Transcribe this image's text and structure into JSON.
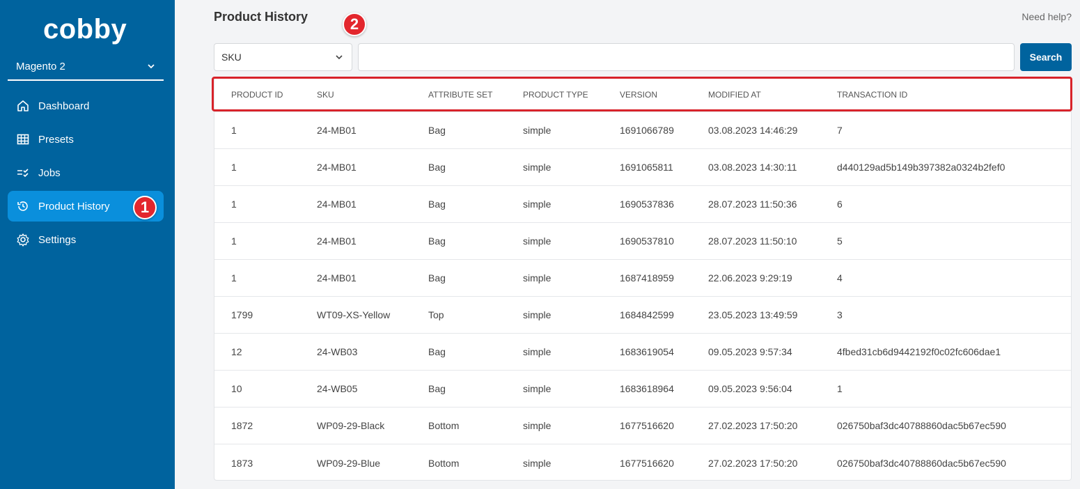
{
  "app": {
    "logo_text": "cobby"
  },
  "sidebar": {
    "shop": "Magento 2",
    "items": [
      {
        "label": "Dashboard",
        "icon": "home-icon",
        "active": false
      },
      {
        "label": "Presets",
        "icon": "grid-icon",
        "active": false
      },
      {
        "label": "Jobs",
        "icon": "list-check-icon",
        "active": false
      },
      {
        "label": "Product History",
        "icon": "history-icon",
        "active": true
      },
      {
        "label": "Settings",
        "icon": "gear-icon",
        "active": false
      }
    ]
  },
  "annotations": {
    "badge1": "1",
    "badge2": "2",
    "badge_color": "#e3262d"
  },
  "header": {
    "title": "Product History",
    "help": "Need help?"
  },
  "filter": {
    "field": "SKU",
    "search_value": "",
    "search_button": "Search"
  },
  "table": {
    "columns": [
      "PRODUCT ID",
      "SKU",
      "ATTRIBUTE SET",
      "PRODUCT TYPE",
      "VERSION",
      "MODIFIED AT",
      "TRANSACTION ID"
    ],
    "rows": [
      [
        "1",
        "24-MB01",
        "Bag",
        "simple",
        "1691066789",
        "03.08.2023 14:46:29",
        "7"
      ],
      [
        "1",
        "24-MB01",
        "Bag",
        "simple",
        "1691065811",
        "03.08.2023 14:30:11",
        "d440129ad5b149b397382a0324b2fef0"
      ],
      [
        "1",
        "24-MB01",
        "Bag",
        "simple",
        "1690537836",
        "28.07.2023 11:50:36",
        "6"
      ],
      [
        "1",
        "24-MB01",
        "Bag",
        "simple",
        "1690537810",
        "28.07.2023 11:50:10",
        "5"
      ],
      [
        "1",
        "24-MB01",
        "Bag",
        "simple",
        "1687418959",
        "22.06.2023 9:29:19",
        "4"
      ],
      [
        "1799",
        "WT09-XS-Yellow",
        "Top",
        "simple",
        "1684842599",
        "23.05.2023 13:49:59",
        "3"
      ],
      [
        "12",
        "24-WB03",
        "Bag",
        "simple",
        "1683619054",
        "09.05.2023 9:57:34",
        "4fbed31cb6d9442192f0c02fc606dae1"
      ],
      [
        "10",
        "24-WB05",
        "Bag",
        "simple",
        "1683618964",
        "09.05.2023 9:56:04",
        "1"
      ],
      [
        "1872",
        "WP09-29-Black",
        "Bottom",
        "simple",
        "1677516620",
        "27.02.2023 17:50:20",
        "026750baf3dc40788860dac5b67ec590"
      ],
      [
        "1873",
        "WP09-29-Blue",
        "Bottom",
        "simple",
        "1677516620",
        "27.02.2023 17:50:20",
        "026750baf3dc40788860dac5b67ec590"
      ]
    ]
  },
  "colors": {
    "sidebar": "#00639e",
    "active": "#0a8fdc",
    "highlight": "#d8232a"
  }
}
